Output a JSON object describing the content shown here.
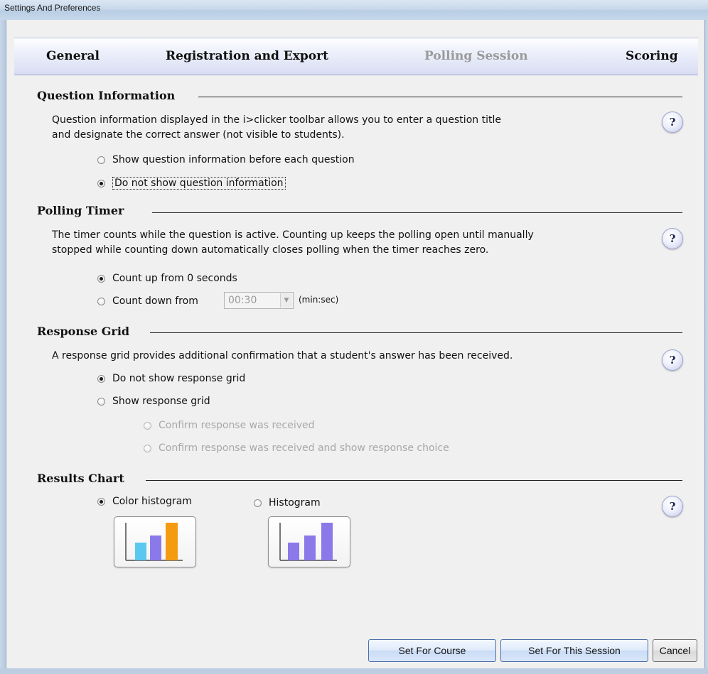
{
  "window": {
    "title": "Settings And Preferences"
  },
  "tabs": [
    {
      "label": "General",
      "active": false
    },
    {
      "label": "Registration and Export",
      "active": false
    },
    {
      "label": "Polling Session",
      "active": true
    },
    {
      "label": "Scoring",
      "active": false
    }
  ],
  "help_label": "?",
  "question_info": {
    "title": "Question Information",
    "description_line1": "Question information displayed in the i>clicker toolbar allows you to enter a question title",
    "description_line2": "and designate the correct answer (not visible to students).",
    "options": [
      {
        "label": "Show question information before each question",
        "checked": false
      },
      {
        "label": "Do not show question information",
        "checked": true
      }
    ]
  },
  "polling_timer": {
    "title": "Polling Timer",
    "description_line1": "The timer counts while the question is active. Counting up keeps the polling open until manually",
    "description_line2": "stopped while counting down automatically closes polling when the timer reaches zero.",
    "options": [
      {
        "label": "Count up from 0 seconds",
        "checked": true
      },
      {
        "label": "Count down from",
        "checked": false
      }
    ],
    "countdown_value": "00:30",
    "countdown_unit": "(min:sec)"
  },
  "response_grid": {
    "title": "Response Grid",
    "description": "A response grid provides additional confirmation that a student's answer has been received.",
    "options": [
      {
        "label": "Do not show response grid",
        "checked": true
      },
      {
        "label": "Show response grid",
        "checked": false
      }
    ],
    "sub_options": [
      {
        "label": "Confirm response was received",
        "checked": false,
        "disabled": true
      },
      {
        "label": "Confirm response was received and show response choice",
        "checked": false,
        "disabled": true
      }
    ]
  },
  "results_chart": {
    "title": "Results Chart",
    "options": [
      {
        "label": "Color histogram",
        "checked": true
      },
      {
        "label": "Histogram",
        "checked": false
      }
    ],
    "color_histogram_colors": [
      "#5bc8f0",
      "#8b79ea",
      "#f59b12"
    ],
    "histogram_color": "#8b79ea"
  },
  "footer": {
    "set_course": "Set For Course",
    "set_session": "Set For This Session",
    "cancel": "Cancel"
  }
}
